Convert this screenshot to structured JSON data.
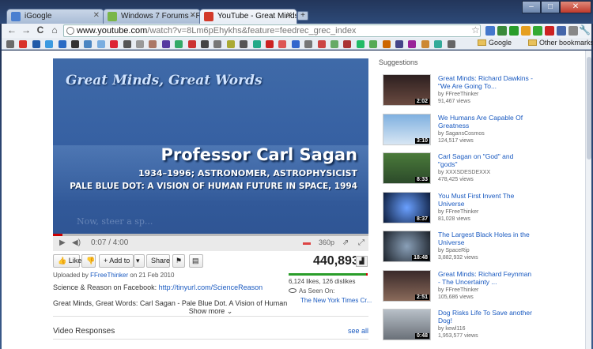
{
  "tabs": [
    {
      "label": "iGoogle",
      "color": "#4a7fd0"
    },
    {
      "label": "Windows 7 Forums - Reply",
      "color": "#7ab648"
    },
    {
      "label": "YouTube - Great Minds: Ca",
      "color": "#d23a2a"
    }
  ],
  "window_controls": {
    "minimize": "–",
    "maximize": "□",
    "close": "✕"
  },
  "toolbar": {
    "back": "←",
    "forward": "→",
    "reload": "C",
    "home": "⌂",
    "url_host": "www.youtube.com",
    "url_path": "/watch?v=8Lm6pEhykhs&feature=feedrec_grec_index"
  },
  "extensions": [
    "#4477cc",
    "#3a8a3a",
    "#2a9d2a",
    "#e6a020",
    "#33aa33",
    "#cc2222",
    "#4466aa",
    "#888888"
  ],
  "bookmarks": {
    "icons": [
      "#6b6b6b",
      "#d9322b",
      "#1f5aa8",
      "#3b9ae0",
      "#2a6bc4",
      "#333",
      "#4b86c2",
      "#7aaee0",
      "#d23",
      "#555",
      "#999",
      "#a76",
      "#553aa0",
      "#3a6",
      "#c33",
      "#444",
      "#777",
      "#aa3",
      "#555",
      "#2a8",
      "#c22",
      "#d55",
      "#36c",
      "#777",
      "#c44",
      "#6a6",
      "#a33",
      "#2b6",
      "#5a5",
      "#c60",
      "#448",
      "#929",
      "#c83",
      "#3a9",
      "#666"
    ],
    "folder1": "Google",
    "folder2": "Other bookmarks"
  },
  "video": {
    "title_overlay": "Great Minds, Great Words",
    "name_overlay": "Professor Carl Sagan",
    "line1": "1934–1996; ASTRONOMER, ASTROPHYSICIST",
    "line2": "PALE BLUE DOT: A VISION OF HUMAN FUTURE IN SPACE, 1994",
    "faint_text": "Now, steer a sp...",
    "time": "0:07 / 4:00",
    "progress": 0.03,
    "quality": "360p",
    "play_icon": "▶",
    "volume_icon": "🔊"
  },
  "actions": {
    "like": "Like",
    "dislike": "👎",
    "add_to": "Add to",
    "share": "Share",
    "flag": "⚑",
    "embed": "▤"
  },
  "stats": {
    "views": "440,893",
    "likes_text": "6,124 likes, 126 dislikes",
    "like_ratio": 0.98,
    "as_seen_on": "As Seen On:",
    "as_seen_link": "The New York Times Cr..."
  },
  "description": {
    "uploaded_prefix": "Uploaded by ",
    "uploader": "FFreeThinker",
    "uploaded_suffix": " on 21 Feb 2010",
    "facebook_prefix": "Science & Reason on Facebook: ",
    "facebook_link": "http://tinyurl.com/ScienceReason",
    "summary": "Great Minds, Great Words: Carl Sagan - Pale Blue Dot. A Vision of Human",
    "show_more": "Show more ⌄"
  },
  "video_responses": {
    "header": "Video Responses",
    "see_all": "see all"
  },
  "suggestions": {
    "header": "Suggestions",
    "items": [
      {
        "title": "Great Minds: Richard Dawkins - \"We Are Going To...",
        "user": "by FFreeThinker",
        "views": "91,467 views",
        "duration": "2:02",
        "bg": "linear-gradient(180deg,#2d2020,#6a4a40)"
      },
      {
        "title": "We Humans Are Capable Of Greatness",
        "user": "by SagansCosmos",
        "views": "124,517 views",
        "duration": "3:10",
        "bg": "linear-gradient(180deg,#7fb0e0,#d8e6f3)"
      },
      {
        "title": "Carl Sagan on \"God\" and \"gods\"",
        "user": "by XXXSDESDEXXX",
        "views": "478,425 views",
        "duration": "8:33",
        "bg": "linear-gradient(180deg,#4a7a3a,#2c4a2a)"
      },
      {
        "title": "You Must First Invent The Universe",
        "user": "by FFreeThinker",
        "views": "81,028 views",
        "duration": "8:37",
        "bg": "radial-gradient(circle,#6aa0ff,#0b1b3a)"
      },
      {
        "title": "The Largest Black Holes in the Universe",
        "user": "by SpaceRip",
        "views": "3,882,932 views",
        "duration": "18:48",
        "bg": "radial-gradient(circle,#8aa0b8,#1a2028)"
      },
      {
        "title": "Great Minds: Richard Feynman - The Uncertainty ...",
        "user": "by FFreeThinker",
        "views": "105,686 views",
        "duration": "2:51",
        "bg": "linear-gradient(180deg,#3a2a2a,#8a6a5a)"
      },
      {
        "title": "Dog Risks Life To Save another Dog!",
        "user": "by kewl116",
        "views": "1,953,577 views",
        "duration": "0:48",
        "bg": "linear-gradient(180deg,#b8c0c8,#6a7078)"
      }
    ]
  }
}
